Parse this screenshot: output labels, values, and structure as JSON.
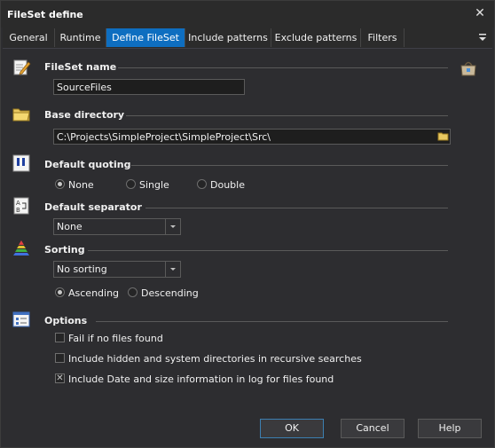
{
  "window": {
    "title": "FileSet define",
    "close_symbol": "✕"
  },
  "tabs": [
    {
      "label": "General"
    },
    {
      "label": "Runtime"
    },
    {
      "label": "Define FileSet",
      "active": true
    },
    {
      "label": "Include patterns"
    },
    {
      "label": "Exclude patterns"
    },
    {
      "label": "Filters"
    }
  ],
  "fileset_name": {
    "title": "FileSet name",
    "value": "SourceFiles"
  },
  "base_directory": {
    "title": "Base directory",
    "value": "C:\\Projects\\SimpleProject\\SimpleProject\\Src\\"
  },
  "default_quoting": {
    "title": "Default quoting",
    "options": [
      "None",
      "Single",
      "Double"
    ],
    "selected": "None"
  },
  "default_separator": {
    "title": "Default separator",
    "value": "None"
  },
  "sorting": {
    "title": "Sorting",
    "value": "No sorting",
    "order_options": [
      "Ascending",
      "Descending"
    ],
    "selected_order": "Ascending"
  },
  "options": {
    "title": "Options",
    "items": [
      {
        "label": "Fail if no files found",
        "checked": false
      },
      {
        "label": "Include hidden and system directories in recursive searches",
        "checked": false
      },
      {
        "label": "Include Date and size information in log for files found",
        "checked": true
      }
    ]
  },
  "buttons": {
    "ok": "OK",
    "cancel": "Cancel",
    "help": "Help"
  },
  "colors": {
    "accent": "#0e6ec0",
    "background": "#2d2d30",
    "text": "#f0f0f0"
  }
}
